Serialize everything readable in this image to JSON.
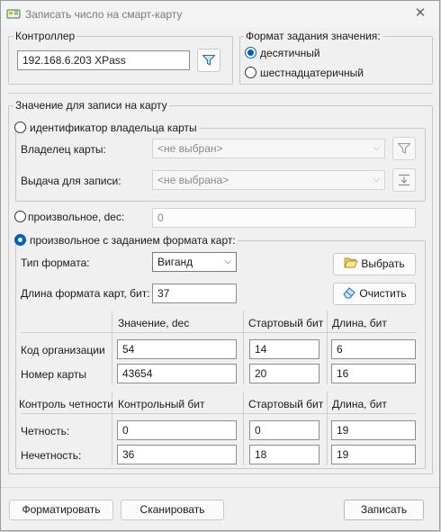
{
  "window": {
    "title": "Записать число на смарт-карту",
    "close_glyph": "✕"
  },
  "controller": {
    "group_title": "Контроллер",
    "value": "192.168.6.203 XPass"
  },
  "value_format": {
    "group_title": "Формат задания значения:",
    "options": [
      {
        "label": "десятичный",
        "selected": true
      },
      {
        "label": "шестнадцатеричный",
        "selected": false
      }
    ]
  },
  "write_value": {
    "group_title": "Значение для записи на карту",
    "owner_id": {
      "option_label": "идентификатор владельца карты",
      "owner_label": "Владелец карты:",
      "owner_value": "<не выбран>",
      "issue_label": "Выдача для записи:",
      "issue_value": "<не выбрана>"
    },
    "arbitrary": {
      "option_label": "произвольное, dec:",
      "value": "0"
    },
    "formatted": {
      "option_label": "произвольное с заданием формата карт:",
      "format_type_label": "Тип формата:",
      "format_type_value": "Виганд",
      "select_button": "Выбрать",
      "length_label": "Длина формата карт, бит:",
      "length_value": "37",
      "clear_button": "Очистить",
      "fields_headers": [
        "Значение, dec",
        "Стартовый бит",
        "Длина, бит"
      ],
      "fields": [
        {
          "label": "Код организации",
          "value": "54",
          "start": "14",
          "length": "6"
        },
        {
          "label": "Номер карты",
          "value": "43654",
          "start": "20",
          "length": "16"
        }
      ],
      "parity_headers": [
        "Контроль четности",
        "Контрольный бит",
        "Стартовый бит",
        "Длина, бит"
      ],
      "parity": [
        {
          "label": "Четность:",
          "control": "0",
          "start": "0",
          "length": "19"
        },
        {
          "label": "Нечетность:",
          "control": "36",
          "start": "18",
          "length": "19"
        }
      ]
    }
  },
  "footer": {
    "format_button": "Форматировать",
    "scan_button": "Сканировать",
    "write_button": "Записать"
  },
  "colors": {
    "accent": "#005fb8",
    "window_bg": "#f0f0f0"
  }
}
